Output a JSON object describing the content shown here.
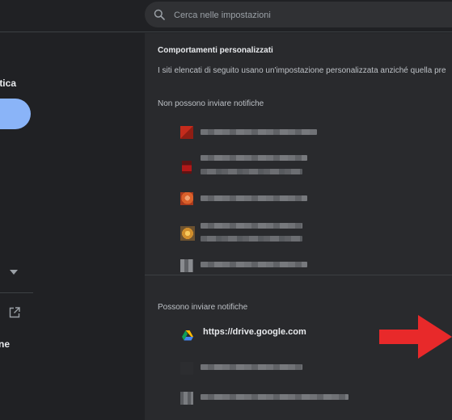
{
  "search": {
    "placeholder": "Cerca nelle impostazioni",
    "icon": "search-icon"
  },
  "sidebar": {
    "label_top": "tica",
    "label_bottom": "ne",
    "accent_color": "#8ab4f8"
  },
  "content": {
    "section_title": "Comportamenti personalizzati",
    "description": "I siti elencati di seguito usano un'impostazione personalizzata anziché quella pre",
    "blocked_title": "Non possono inviare notifiche",
    "allowed_title": "Possono inviare notifiche",
    "allowed_sites": [
      {
        "url": "https://drive.google.com",
        "icon": "google-drive-icon"
      }
    ]
  },
  "annotation": {
    "arrow_color": "#e8292a"
  }
}
